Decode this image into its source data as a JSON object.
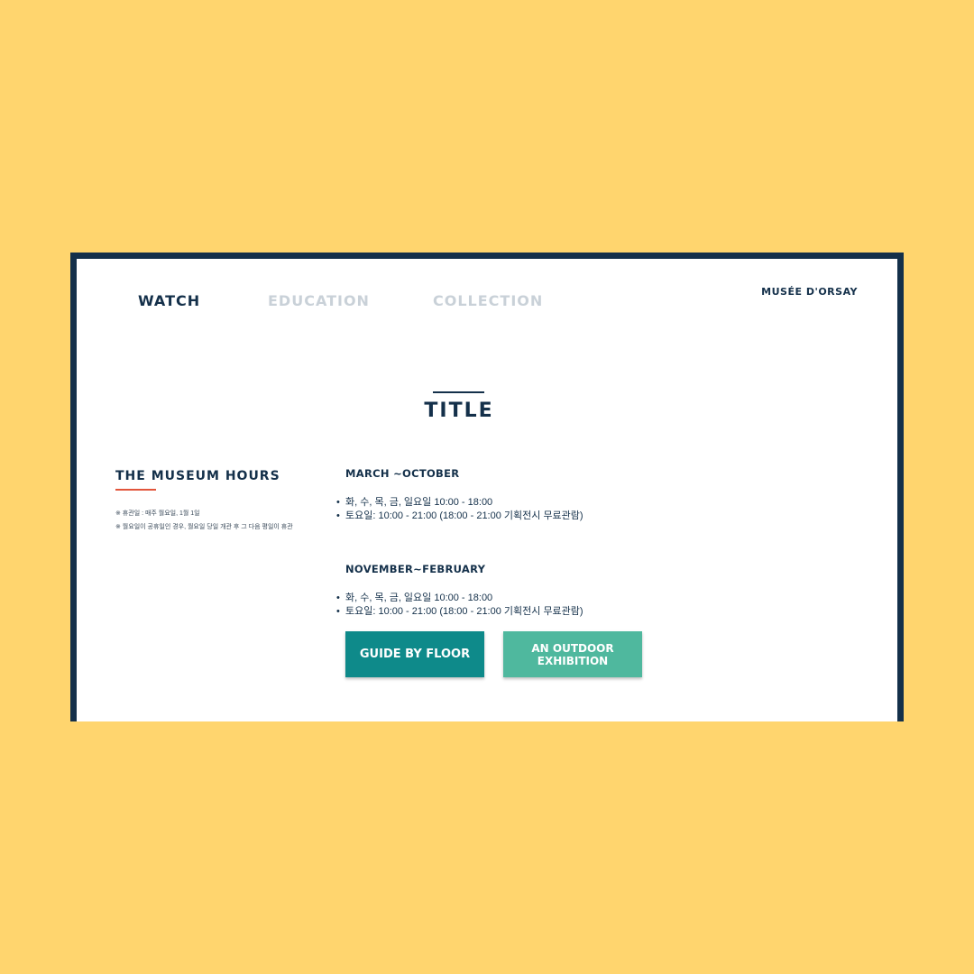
{
  "colors": {
    "background": "#FFD56E",
    "frame": "#14304A",
    "text_primary": "#14304A",
    "nav_inactive": "#C9D1D8",
    "accent_underline": "#E2553B",
    "button_primary": "#0E8A8A",
    "button_secondary": "#4FB89E"
  },
  "nav": {
    "items": [
      {
        "label": "WATCH",
        "active": true
      },
      {
        "label": "EDUCATION",
        "active": false
      },
      {
        "label": "COLLECTION",
        "active": false
      }
    ],
    "brand": "MUSÉE D'ORSAY"
  },
  "main": {
    "title": "TITLE"
  },
  "hours": {
    "heading": "THE MUSEUM HOURS",
    "notes": [
      "※ 휴관일 : 매주 월요일, 1월 1일",
      "※ 월요일이 공휴일인 경우, 월요일 당일 개관 후 그 다음 평일이 휴관"
    ]
  },
  "seasons": [
    {
      "heading": "MARCH ~OCTOBER",
      "lines": [
        "화, 수, 목, 금, 일요일 10:00 - 18:00",
        "토요일: 10:00 - 21:00 (18:00 - 21:00 기획전시 무료관람)"
      ]
    },
    {
      "heading": "NOVEMBER~FEBRUARY",
      "lines": [
        "화, 수, 목, 금, 일요일 10:00 - 18:00",
        "토요일: 10:00 - 21:00 (18:00 - 21:00 기획전시 무료관람)"
      ]
    }
  ],
  "buttons": {
    "guide_label": "GUIDE BY FLOOR",
    "outdoor_label": "AN OUTDOOR\nEXHIBITION"
  }
}
